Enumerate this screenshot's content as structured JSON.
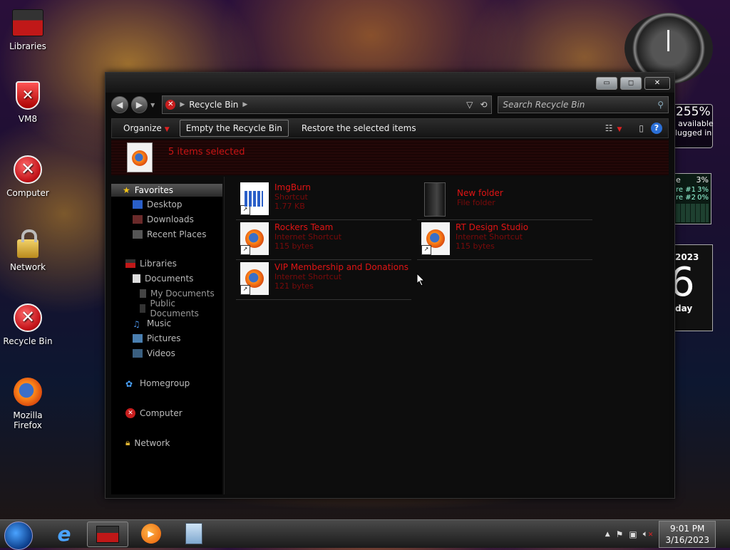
{
  "desktop": {
    "icons": [
      {
        "label": "Libraries"
      },
      {
        "label": "VM8"
      },
      {
        "label": "Computer"
      },
      {
        "label": "Network"
      },
      {
        "label": "Recycle Bin"
      },
      {
        "label": "Mozilla\nFirefox"
      }
    ]
  },
  "window": {
    "buttons": {
      "minimize": "▭",
      "maximize": "◻",
      "close": "✕"
    },
    "breadcrumb": "Recycle Bin",
    "search_placeholder": "Search Recycle Bin",
    "toolbar": {
      "organize": "Organize",
      "empty": "Empty the Recycle Bin",
      "restore": "Restore the selected items"
    },
    "details": {
      "count": "5 items selected"
    },
    "nav": {
      "favorites": "Favorites",
      "favorites_items": [
        "Desktop",
        "Downloads",
        "Recent Places"
      ],
      "libraries": "Libraries",
      "documents": "Documents",
      "doc_sub": [
        "My Documents",
        "Public Documents"
      ],
      "lib_items": [
        "Music",
        "Pictures",
        "Videos"
      ],
      "homegroup": "Homegroup",
      "computer": "Computer",
      "network": "Network"
    },
    "items": [
      {
        "name": "ImgBurn",
        "type": "Shortcut",
        "size": "1.77 KB",
        "icon": "imgburn-icon"
      },
      {
        "name": "New folder",
        "type": "File folder",
        "size": "",
        "icon": "folder-icon"
      },
      {
        "name": "Rockers Team",
        "type": "Internet Shortcut",
        "size": "115 bytes",
        "icon": "firefox-icon"
      },
      {
        "name": "RT Design Studio",
        "type": "Internet Shortcut",
        "size": "115 bytes",
        "icon": "firefox-icon"
      },
      {
        "name": "VIP Membership and Donations",
        "type": "Internet Shortcut",
        "size": "121 bytes",
        "icon": "firefox-icon"
      }
    ]
  },
  "gadgets": {
    "battery_pct": "255%",
    "battery_state": "available",
    "battery_plug": "lugged in",
    "cpu_title": "e",
    "cpu_total": "3%",
    "core1_label": "re #1",
    "core1_val": "3%",
    "core2_label": "re #2",
    "core2_val": "0%",
    "cal_year": "2023",
    "cal_day": "6",
    "cal_weekday": "day"
  },
  "taskbar": {
    "time": "9:01 PM",
    "date": "3/16/2023"
  }
}
